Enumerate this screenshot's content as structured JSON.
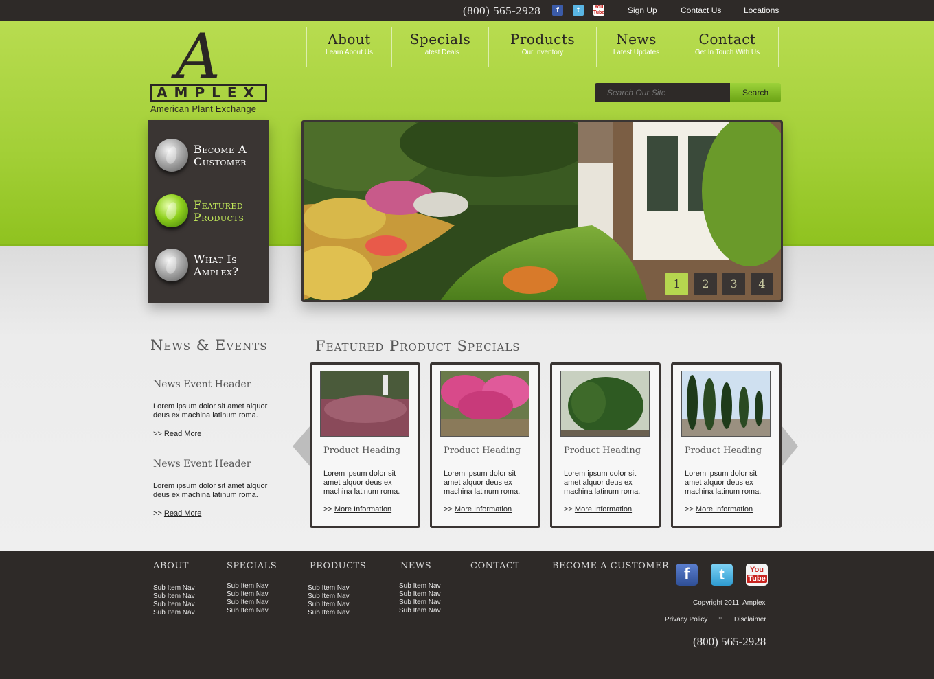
{
  "topbar": {
    "phone": "(800)  565-2928",
    "social": [
      "facebook-icon",
      "twitter-icon",
      "youtube-icon"
    ],
    "links": [
      "Sign Up",
      "Contact Us",
      "Locations"
    ]
  },
  "logo": {
    "letter": "A",
    "name": "AMPLEX",
    "tagline": "American Plant Exchange"
  },
  "nav": [
    {
      "label": "About",
      "sub": "Learn About Us"
    },
    {
      "label": "Specials",
      "sub": "Latest Deals"
    },
    {
      "label": "Products",
      "sub": "Our Inventory"
    },
    {
      "label": "News",
      "sub": "Latest Updates"
    },
    {
      "label": "Contact",
      "sub": "Get In Touch With Us"
    }
  ],
  "search": {
    "placeholder": "Search Our Site",
    "button": "Search"
  },
  "side_menu": [
    {
      "line1": "Become A",
      "line2": "Customer",
      "active": false
    },
    {
      "line1": "Featured",
      "line2": "Products",
      "active": true
    },
    {
      "line1": "What Is",
      "line2": "Amplex?",
      "active": false
    }
  ],
  "slider": {
    "buttons": [
      "1",
      "2",
      "3",
      "4"
    ],
    "active_index": 0
  },
  "news": {
    "title": "News & Events",
    "items": [
      {
        "header": "News Event Header",
        "body": "Lorem ipsum dolor sit amet alquor deus ex machina latinum roma.",
        "more_prefix": ">>",
        "more": "Read More"
      },
      {
        "header": "News Event Header",
        "body": "Lorem ipsum dolor sit amet alquor deus ex machina latinum roma.",
        "more_prefix": ">>",
        "more": "Read More"
      }
    ]
  },
  "featured": {
    "title": "Featured Product Specials",
    "cards": [
      {
        "heading": "Product Heading",
        "body": "Lorem ipsum dolor sit amet alquor deus ex machina latinum roma.",
        "more_prefix": ">>",
        "more": "More Information"
      },
      {
        "heading": "Product Heading",
        "body": "Lorem ipsum dolor sit amet alquor deus ex machina latinum roma.",
        "more_prefix": ">>",
        "more": "More Information"
      },
      {
        "heading": "Product Heading",
        "body": "Lorem ipsum dolor sit amet alquor deus ex machina latinum roma.",
        "more_prefix": ">>",
        "more": "More Information"
      },
      {
        "heading": "Product Heading",
        "body": "Lorem ipsum dolor sit amet alquor deus ex machina latinum roma.",
        "more_prefix": ">>",
        "more": "More Information"
      }
    ]
  },
  "footer": {
    "columns": [
      {
        "title": "ABOUT",
        "items": [
          "Sub Item Nav",
          "Sub Item Nav",
          "Sub Item Nav",
          "Sub Item Nav"
        ]
      },
      {
        "title": "SPECIALS",
        "items": [
          "Sub Item Nav",
          "Sub Item Nav",
          "Sub Item Nav",
          "Sub Item Nav"
        ]
      },
      {
        "title": "PRODUCTS",
        "items": [
          "Sub Item Nav",
          "Sub Item Nav",
          "Sub Item Nav",
          "Sub Item Nav"
        ]
      },
      {
        "title": "NEWS",
        "items": [
          "Sub Item Nav",
          "Sub Item Nav",
          "Sub Item Nav",
          "Sub Item Nav"
        ]
      },
      {
        "title": "CONTACT",
        "items": []
      },
      {
        "title": "BECOME A CUSTOMER",
        "items": []
      }
    ],
    "copyright": "Copyright 2011, Amplex",
    "privacy": "Privacy Policy",
    "separator": "::",
    "disclaimer": "Disclaimer",
    "phone": "(800)  565-2928",
    "social": [
      "facebook-icon",
      "twitter-icon",
      "youtube-icon"
    ]
  },
  "colors": {
    "accent_green": "#a2cf36",
    "dark": "#3a3533",
    "topbar": "#2e2a28"
  }
}
